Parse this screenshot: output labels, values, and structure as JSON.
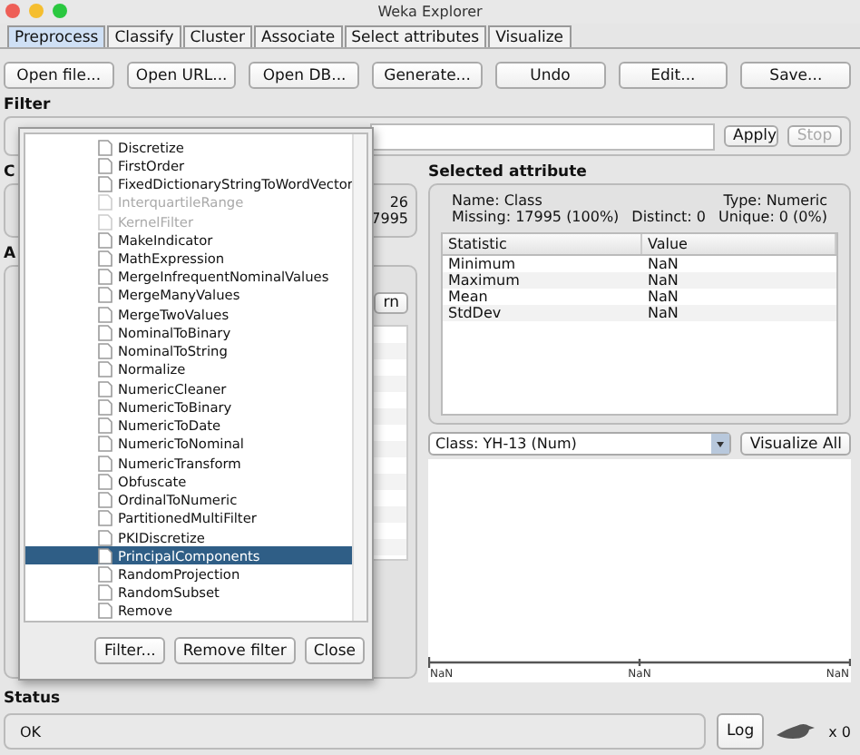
{
  "window": {
    "title": "Weka Explorer"
  },
  "tabs": [
    {
      "label": "Preprocess",
      "selected": true
    },
    {
      "label": "Classify",
      "selected": false
    },
    {
      "label": "Cluster",
      "selected": false
    },
    {
      "label": "Associate",
      "selected": false
    },
    {
      "label": "Select attributes",
      "selected": false
    },
    {
      "label": "Visualize",
      "selected": false
    }
  ],
  "toolbar": [
    "Open file...",
    "Open URL...",
    "Open DB...",
    "Generate...",
    "Undo",
    "Edit...",
    "Save..."
  ],
  "filter": {
    "label": "Filter",
    "apply": "Apply",
    "stop": "Stop",
    "stop_disabled": true
  },
  "current_relation": {
    "label": "C",
    "values": [
      "26",
      "7995"
    ]
  },
  "attributes": {
    "label": "A",
    "button": "rn"
  },
  "selected_attribute": {
    "label": "Selected attribute",
    "name": "Name: Class",
    "type": "Type: Numeric",
    "missing": "Missing: 17995 (100%)",
    "distinct": "Distinct: 0",
    "unique": "Unique: 0 (0%)",
    "columns": [
      "Statistic",
      "Value"
    ],
    "rows": [
      [
        "Minimum",
        "NaN"
      ],
      [
        "Maximum",
        "NaN"
      ],
      [
        "Mean",
        "NaN"
      ],
      [
        "StdDev",
        "NaN"
      ]
    ],
    "class_select": "Class: YH-13 (Num)",
    "visualize_all": "Visualize All",
    "axis_labels": [
      "NaN",
      "NaN",
      "NaN"
    ]
  },
  "filter_popup": {
    "items": [
      {
        "label": "Discretize",
        "disabled": false,
        "selected": false
      },
      {
        "label": "FirstOrder",
        "disabled": false,
        "selected": false
      },
      {
        "label": "FixedDictionaryStringToWordVector",
        "disabled": false,
        "selected": false
      },
      {
        "label": "InterquartileRange",
        "disabled": true,
        "selected": false
      },
      {
        "label": "KernelFilter",
        "disabled": true,
        "selected": false
      },
      {
        "label": "MakeIndicator",
        "disabled": false,
        "selected": false
      },
      {
        "label": "MathExpression",
        "disabled": false,
        "selected": false
      },
      {
        "label": "MergeInfrequentNominalValues",
        "disabled": false,
        "selected": false
      },
      {
        "label": "MergeManyValues",
        "disabled": false,
        "selected": false
      },
      {
        "label": "MergeTwoValues",
        "disabled": false,
        "selected": false
      },
      {
        "label": "NominalToBinary",
        "disabled": false,
        "selected": false
      },
      {
        "label": "NominalToString",
        "disabled": false,
        "selected": false
      },
      {
        "label": "Normalize",
        "disabled": false,
        "selected": false
      },
      {
        "label": "NumericCleaner",
        "disabled": false,
        "selected": false
      },
      {
        "label": "NumericToBinary",
        "disabled": false,
        "selected": false
      },
      {
        "label": "NumericToDate",
        "disabled": false,
        "selected": false
      },
      {
        "label": "NumericToNominal",
        "disabled": false,
        "selected": false
      },
      {
        "label": "NumericTransform",
        "disabled": false,
        "selected": false
      },
      {
        "label": "Obfuscate",
        "disabled": false,
        "selected": false
      },
      {
        "label": "OrdinalToNumeric",
        "disabled": false,
        "selected": false
      },
      {
        "label": "PartitionedMultiFilter",
        "disabled": false,
        "selected": false
      },
      {
        "label": "PKIDiscretize",
        "disabled": false,
        "selected": false
      },
      {
        "label": "PrincipalComponents",
        "disabled": false,
        "selected": true
      },
      {
        "label": "RandomProjection",
        "disabled": false,
        "selected": false
      },
      {
        "label": "RandomSubset",
        "disabled": false,
        "selected": false
      },
      {
        "label": "Remove",
        "disabled": false,
        "selected": false
      }
    ],
    "buttons": [
      "Filter...",
      "Remove filter",
      "Close"
    ]
  },
  "status": {
    "label": "Status",
    "text": "OK",
    "log": "Log",
    "count": "x 0"
  }
}
